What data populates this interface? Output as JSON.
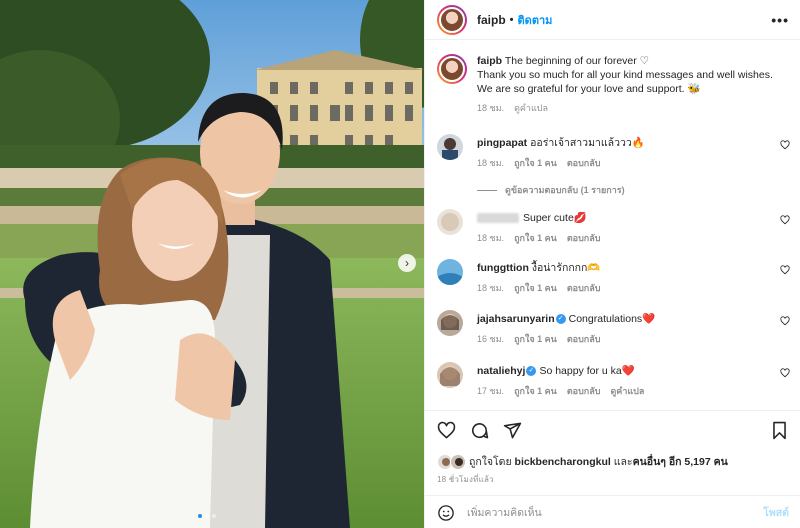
{
  "header": {
    "username": "faipb",
    "separator": "•",
    "follow_label": "ติดตาม",
    "more_icon": "more-horizontal-icon"
  },
  "caption": {
    "username": "faipb",
    "line1": "The beginning of our forever ♡",
    "line2": "Thank you so much for all your kind messages and well wishes.",
    "line3": "We are so grateful for your love and support. 🐝",
    "time": "18 ชม.",
    "translate": "ดูคำแปล"
  },
  "comments": [
    {
      "username": "pingpapat",
      "text": "ออร่าเจ้าสาวมาแล้ววว🔥",
      "time": "18 ชม.",
      "likes": "ถูกใจ 1 คน",
      "reply": "ตอบกลับ",
      "verified": false
    },
    {
      "username": "",
      "text": "Super cute💋",
      "time": "18 ชม.",
      "likes": "ถูกใจ 1 คน",
      "reply": "ตอบกลับ",
      "verified": false
    },
    {
      "username": "funggttion",
      "text": "งื้อน่ารักกกก🫶",
      "time": "18 ชม.",
      "likes": "ถูกใจ 1 คน",
      "reply": "ตอบกลับ",
      "verified": false
    },
    {
      "username": "jajahsarunyarin",
      "text": "Congratulations❤️",
      "time": "16 ชม.",
      "likes": "ถูกใจ 1 คน",
      "reply": "ตอบกลับ",
      "verified": true
    },
    {
      "username": "nataliehyj",
      "text": "So happy for u ka❤️",
      "time": "17 ชม.",
      "likes": "ถูกใจ 1 คน",
      "reply": "ตอบกลับ",
      "translate": "ดูคำแปล",
      "verified": true
    }
  ],
  "replies_label": "ดูข้อความตอบกลับ (1 รายการ)",
  "likes": {
    "prefix": "ถูกใจโดย",
    "user": "bickbencharongkul",
    "and": "และ",
    "others": "คนอื่นๆ อีก 5,197 คน"
  },
  "post_time": "18 ชั่วโมงที่แล้ว",
  "add_comment": {
    "placeholder": "เพิ่มความคิดเห็น",
    "post_label": "โพสต์"
  },
  "colors": {
    "accent": "#0095f6",
    "verified": "#3897f0",
    "muted": "#8e8e8e"
  }
}
